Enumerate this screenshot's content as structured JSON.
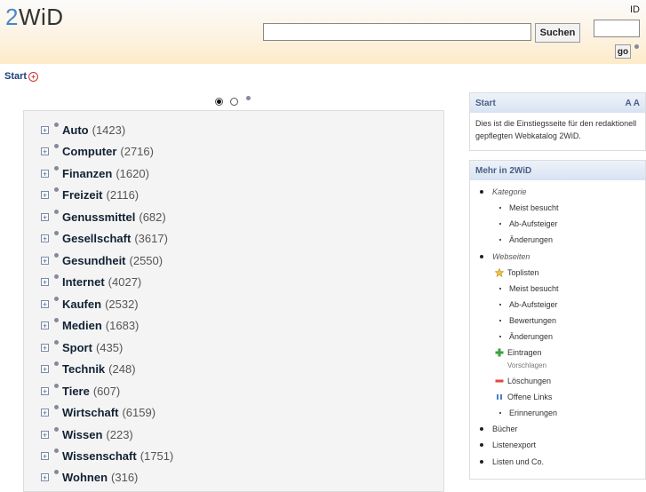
{
  "header": {
    "logo": "2WiD",
    "search_button": "Suchen",
    "id_label": "ID",
    "go_button": "go"
  },
  "breadcrumb": {
    "label": "Start"
  },
  "categories": [
    {
      "name": "Auto",
      "count": "(1423)"
    },
    {
      "name": "Computer",
      "count": "(2716)"
    },
    {
      "name": "Finanzen",
      "count": "(1620)"
    },
    {
      "name": "Freizeit",
      "count": "(2116)"
    },
    {
      "name": "Genussmittel",
      "count": "(682)"
    },
    {
      "name": "Gesellschaft",
      "count": "(3617)"
    },
    {
      "name": "Gesundheit",
      "count": "(2550)"
    },
    {
      "name": "Internet",
      "count": "(4027)"
    },
    {
      "name": "Kaufen",
      "count": "(2532)"
    },
    {
      "name": "Medien",
      "count": "(1683)"
    },
    {
      "name": "Sport",
      "count": "(435)"
    },
    {
      "name": "Technik",
      "count": "(248)"
    },
    {
      "name": "Tiere",
      "count": "(607)"
    },
    {
      "name": "Wirtschaft",
      "count": "(6159)"
    },
    {
      "name": "Wissen",
      "count": "(223)"
    },
    {
      "name": "Wissenschaft",
      "count": "(1751)"
    },
    {
      "name": "Wohnen",
      "count": "(316)"
    }
  ],
  "start_panel": {
    "title": "Start",
    "font_toggle": "A A",
    "text": "Dies ist die Einstiegsseite für den redaktionell gepflegten Webkatalog 2WiD."
  },
  "more_panel": {
    "title": "Mehr in 2WiD",
    "kategorie": "Kategorie",
    "kat_meist": "Meist besucht",
    "kat_ab": "Ab-Aufsteiger",
    "kat_aend": "Änderungen",
    "webseiten": "Webseiten",
    "toplisten": "Toplisten",
    "web_meist": "Meist besucht",
    "web_ab": "Ab-Aufsteiger",
    "bewertungen": "Bewertungen",
    "web_aend": "Änderungen",
    "eintragen": "Eintragen",
    "vorschlagen": "Vorschlagen",
    "loeschungen": "Löschungen",
    "offene_links": "Offene Links",
    "erinnerungen": "Erinnerungen",
    "buecher": "Bücher",
    "listenexport": "Listenexport",
    "listen_co": "Listen und Co."
  }
}
